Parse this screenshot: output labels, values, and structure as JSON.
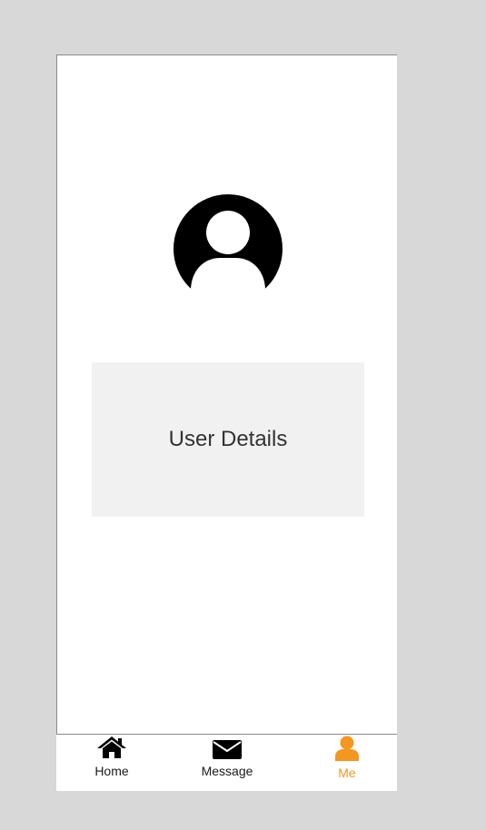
{
  "profile": {
    "avatar_icon": "user-circle-icon",
    "details_label": "User Details"
  },
  "tabbar": {
    "active_color": "#f5961e",
    "items": [
      {
        "label": "Home",
        "icon": "home-icon"
      },
      {
        "label": "Message",
        "icon": "envelope-icon"
      },
      {
        "label": "Me",
        "icon": "user-icon",
        "active": true
      }
    ]
  }
}
